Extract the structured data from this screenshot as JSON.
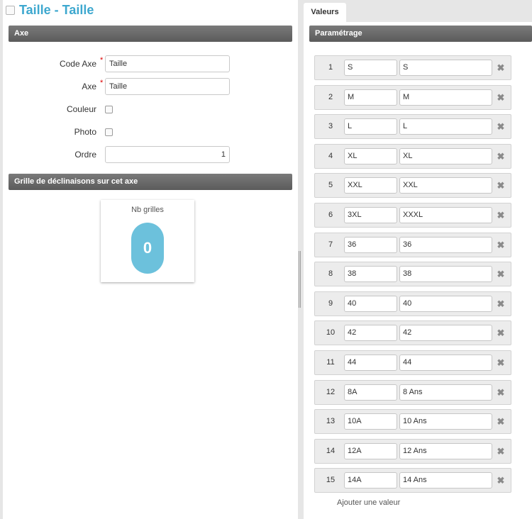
{
  "page_title": "Taille - Taille",
  "sections": {
    "axe": "Axe",
    "grille": "Grille de déclinaisons sur cet axe",
    "parametrage": "Paramétrage"
  },
  "form": {
    "code_axe_label": "Code Axe",
    "code_axe_value": "Taille",
    "axe_label": "Axe",
    "axe_value": "Taille",
    "couleur_label": "Couleur",
    "photo_label": "Photo",
    "ordre_label": "Ordre",
    "ordre_value": "1",
    "required_mark": "*"
  },
  "stat": {
    "title": "Nb grilles",
    "value": "0",
    "accent_color": "#6cc1dc"
  },
  "tab_label": "Valeurs",
  "delete_icon": "close-icon",
  "values": [
    {
      "index": "1",
      "code": "S",
      "label": "S"
    },
    {
      "index": "2",
      "code": "M",
      "label": "M"
    },
    {
      "index": "3",
      "code": "L",
      "label": "L"
    },
    {
      "index": "4",
      "code": "XL",
      "label": "XL"
    },
    {
      "index": "5",
      "code": "XXL",
      "label": "XXL"
    },
    {
      "index": "6",
      "code": "3XL",
      "label": "XXXL"
    },
    {
      "index": "7",
      "code": "36",
      "label": "36"
    },
    {
      "index": "8",
      "code": "38",
      "label": "38"
    },
    {
      "index": "9",
      "code": "40",
      "label": "40"
    },
    {
      "index": "10",
      "code": "42",
      "label": "42"
    },
    {
      "index": "11",
      "code": "44",
      "label": "44"
    },
    {
      "index": "12",
      "code": "8A",
      "label": "8 Ans"
    },
    {
      "index": "13",
      "code": "10A",
      "label": "10 Ans"
    },
    {
      "index": "14",
      "code": "12A",
      "label": "12 Ans"
    },
    {
      "index": "15",
      "code": "14A",
      "label": "14 Ans"
    }
  ],
  "add_value_label": "Ajouter une valeur"
}
